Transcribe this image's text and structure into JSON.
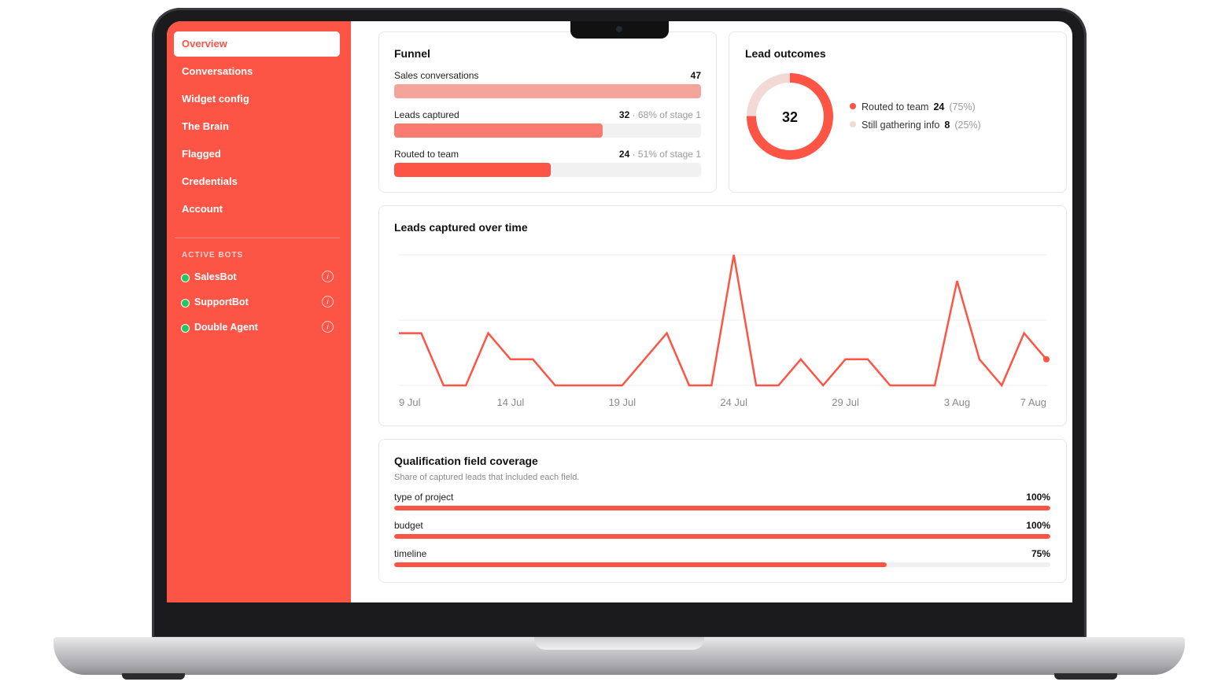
{
  "sidebar": {
    "items": [
      {
        "label": "Overview",
        "active": true
      },
      {
        "label": "Conversations"
      },
      {
        "label": "Widget config"
      },
      {
        "label": "The Brain"
      },
      {
        "label": "Flagged"
      },
      {
        "label": "Credentials"
      },
      {
        "label": "Account"
      }
    ],
    "bots_heading": "ACTIVE BOTS",
    "bots": [
      {
        "name": "SalesBot",
        "status": "active"
      },
      {
        "name": "SupportBot",
        "status": "active"
      },
      {
        "name": "Double Agent",
        "status": "active"
      }
    ],
    "info_glyph": "i"
  },
  "funnel": {
    "title": "Funnel",
    "stages": [
      {
        "label": "Sales conversations",
        "value": "47",
        "sub": "",
        "fraction": 1.0,
        "color": "#f5a49b"
      },
      {
        "label": "Leads captured",
        "value": "32",
        "sub": " · 68% of stage 1",
        "fraction": 0.68,
        "color": "#f97b6f"
      },
      {
        "label": "Routed to team",
        "value": "24",
        "sub": " · 51% of stage 1",
        "fraction": 0.51,
        "color": "#fd5545"
      }
    ]
  },
  "outcomes": {
    "title": "Lead outcomes",
    "total": "32",
    "items": [
      {
        "label": "Routed to team",
        "count": "24",
        "pct": "(75%)",
        "color": "#fd5545",
        "fraction": 0.75
      },
      {
        "label": "Still gathering info",
        "count": "8",
        "pct": "(25%)",
        "color": "#f2d9d6",
        "fraction": 0.25
      }
    ]
  },
  "timeline": {
    "title": "Leads captured over time"
  },
  "chart_data": {
    "type": "line",
    "x": [
      "9 Jul",
      "10 Jul",
      "11 Jul",
      "12 Jul",
      "13 Jul",
      "14 Jul",
      "15 Jul",
      "16 Jul",
      "17 Jul",
      "18 Jul",
      "19 Jul",
      "20 Jul",
      "21 Jul",
      "22 Jul",
      "23 Jul",
      "24 Jul",
      "25 Jul",
      "26 Jul",
      "27 Jul",
      "28 Jul",
      "29 Jul",
      "30 Jul",
      "31 Jul",
      "1 Aug",
      "2 Aug",
      "3 Aug",
      "4 Aug",
      "5 Aug",
      "6 Aug",
      "7 Aug"
    ],
    "tick_labels": [
      "9 Jul",
      "14 Jul",
      "19 Jul",
      "24 Jul",
      "29 Jul",
      "3 Aug",
      "7 Aug"
    ],
    "series": [
      {
        "values": [
          2,
          2,
          0,
          0,
          2,
          1,
          1,
          0,
          0,
          0,
          0,
          1,
          2,
          0,
          0,
          5,
          0,
          0,
          1,
          0,
          1,
          1,
          0,
          0,
          0,
          4,
          1,
          0,
          2,
          1
        ]
      }
    ],
    "ylim": [
      0,
      5
    ],
    "grid": true,
    "color": "#fd5545"
  },
  "coverage": {
    "title": "Qualification field coverage",
    "subtitle": "Share of captured leads that included each field.",
    "fields": [
      {
        "label": "type of project",
        "value": "100%",
        "fraction": 1.0
      },
      {
        "label": "budget",
        "value": "100%",
        "fraction": 1.0
      },
      {
        "label": "timeline",
        "value": "75%",
        "fraction": 0.75
      }
    ]
  }
}
